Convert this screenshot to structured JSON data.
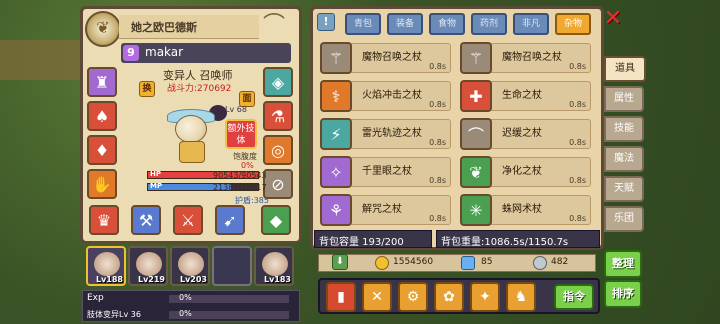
{
  "character": {
    "name_title": "她之欧巴德斯",
    "player_name": "makar",
    "level_badge": "9",
    "class": "变异人 召唤师",
    "power_label": "战斗力:270692",
    "extra_skill_btn": "额外技体",
    "satiety_label": "饱腹度",
    "satiety_value": "0%",
    "level_mini": "Lv 68",
    "hp_label": "HP",
    "hp_value": "90543/90543",
    "hp_fraction": 1.0,
    "mp_label": "MP",
    "mp_value": "21387/28517",
    "mp_fraction": 0.75,
    "shield_value": "护盾:385",
    "btn_swap": "换",
    "btn_face": "面"
  },
  "party": [
    {
      "level": "Lv188",
      "active": true
    },
    {
      "level": "Lv219",
      "active": false
    },
    {
      "level": "Lv203",
      "active": false
    },
    {
      "level": "",
      "active": false
    },
    {
      "level": "Lv183",
      "active": false
    }
  ],
  "exp": {
    "exp_label": "Exp",
    "exp_pct": "0%",
    "body_label": "肢体变异Lv 36",
    "body_pct": "0%"
  },
  "inventory": {
    "tabs": [
      "青包",
      "装备",
      "食物",
      "药剂",
      "非凡",
      "杂物"
    ],
    "active_tab": "杂物",
    "items": [
      {
        "name": "魔物召唤之杖",
        "time": "0.8s",
        "color": "#9a8a78"
      },
      {
        "name": "魔物召唤之杖",
        "time": "0.8s",
        "color": "#9a8a78"
      },
      {
        "name": "火焰冲击之杖",
        "time": "0.8s",
        "color": "#e07a2a"
      },
      {
        "name": "生命之杖",
        "time": "0.8s",
        "color": "#d8503a"
      },
      {
        "name": "雷光轨迹之杖",
        "time": "0.8s",
        "color": "#4aa8a0"
      },
      {
        "name": "迟缓之杖",
        "time": "0.8s",
        "color": "#9a8a78"
      },
      {
        "name": "千里眼之杖",
        "time": "0.8s",
        "color": "#a06ad0"
      },
      {
        "name": "净化之杖",
        "time": "0.8s",
        "color": "#4aa050"
      },
      {
        "name": "解咒之杖",
        "time": "0.8s",
        "color": "#a06ad0"
      },
      {
        "name": "蛛网术杖",
        "time": "0.8s",
        "color": "#4aa050"
      }
    ],
    "capacity": "背包容量 193/200",
    "weight": "背包重量:1086.5s/1150.7s"
  },
  "side_tabs": [
    "道具",
    "属性",
    "技能",
    "魔法",
    "天赋",
    "乐团"
  ],
  "side_active": "道具",
  "currency": {
    "gold": "1554560",
    "gem": "85",
    "coin": "482"
  },
  "buttons": {
    "arrange": "整理",
    "sort": "排序",
    "command": "指令"
  }
}
